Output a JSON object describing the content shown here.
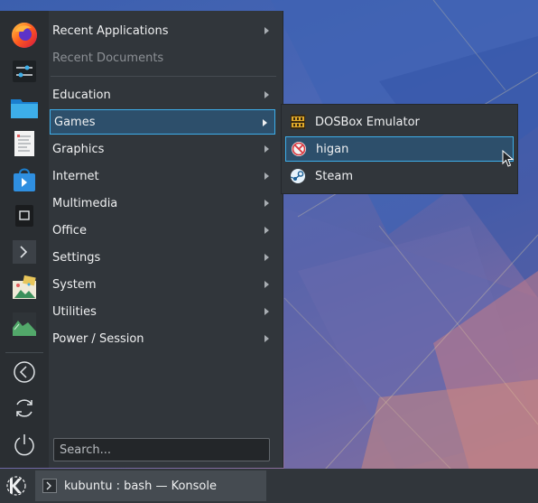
{
  "favorites": [
    {
      "name": "firefox-icon"
    },
    {
      "name": "system-settings-icon"
    },
    {
      "name": "folder-icon"
    },
    {
      "name": "text-editor-icon"
    },
    {
      "name": "software-store-icon"
    },
    {
      "name": "notes-icon"
    },
    {
      "name": "terminal-icon"
    },
    {
      "name": "image-viewer-icon"
    },
    {
      "name": "system-monitor-icon"
    }
  ],
  "session_icons": [
    "logout-icon",
    "restart-icon",
    "shutdown-icon"
  ],
  "menu": {
    "recent_applications": "Recent Applications",
    "recent_documents": "Recent Documents",
    "categories": [
      {
        "label": "Education",
        "selected": false
      },
      {
        "label": "Games",
        "selected": true
      },
      {
        "label": "Graphics",
        "selected": false
      },
      {
        "label": "Internet",
        "selected": false
      },
      {
        "label": "Multimedia",
        "selected": false
      },
      {
        "label": "Office",
        "selected": false
      },
      {
        "label": "Settings",
        "selected": false
      },
      {
        "label": "System",
        "selected": false
      },
      {
        "label": "Utilities",
        "selected": false
      },
      {
        "label": "Power / Session",
        "selected": false
      }
    ],
    "search_placeholder": "Search..."
  },
  "submenu": {
    "items": [
      {
        "label": "DOSBox Emulator",
        "icon": "dosbox-icon",
        "selected": false
      },
      {
        "label": "higan",
        "icon": "higan-icon",
        "selected": true
      },
      {
        "label": "Steam",
        "icon": "steam-icon",
        "selected": false
      }
    ]
  },
  "taskbar": {
    "task_label": "kubuntu : bash — Konsole"
  },
  "colors": {
    "accent": "#3daee9",
    "menu_bg": "#31363b",
    "selection_bg": "#2d4f6b"
  }
}
